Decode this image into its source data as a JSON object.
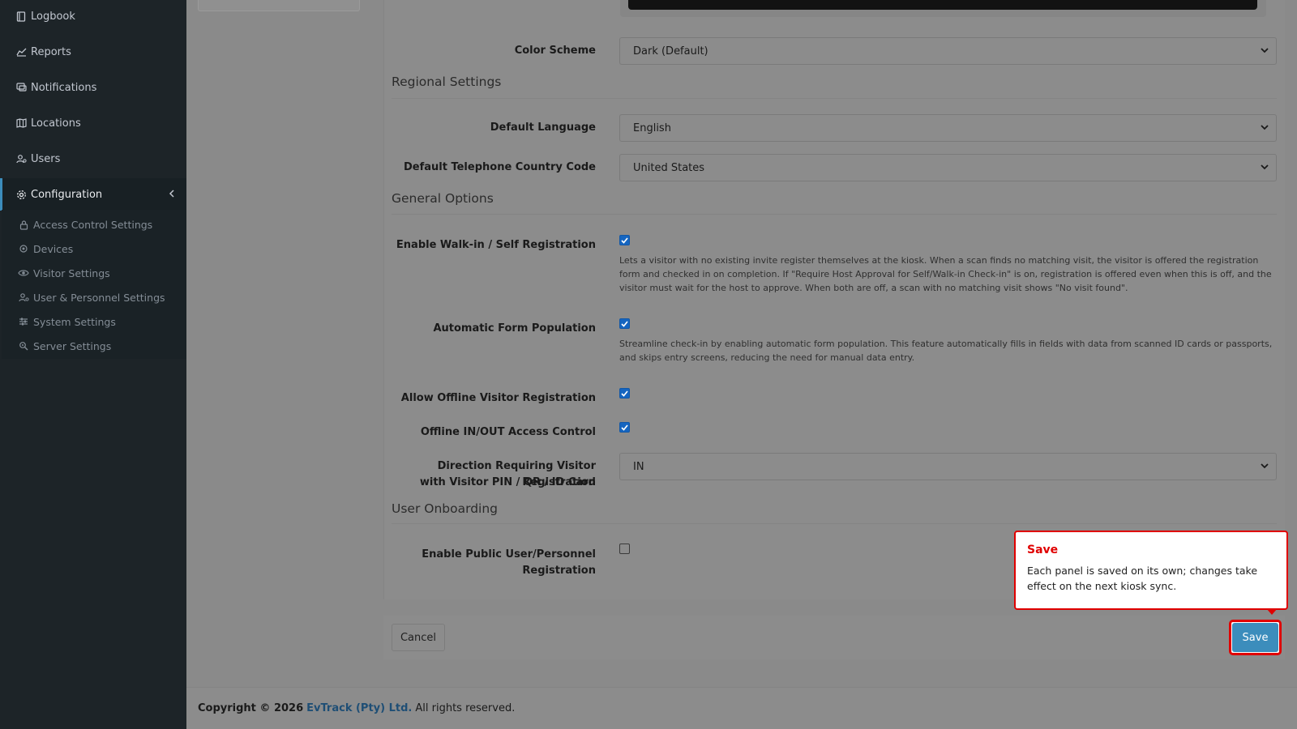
{
  "sidebar": {
    "items": [
      {
        "label": "Logbook",
        "icon": "book-icon"
      },
      {
        "label": "Reports",
        "icon": "chart-icon"
      },
      {
        "label": "Notifications",
        "icon": "chat-icon"
      },
      {
        "label": "Locations",
        "icon": "map-icon"
      },
      {
        "label": "Users",
        "icon": "users-icon"
      },
      {
        "label": "Configuration",
        "icon": "gear-icon"
      }
    ],
    "sub_items": [
      {
        "label": "Access Control Settings",
        "icon": "lock-icon"
      },
      {
        "label": "Devices",
        "icon": "device-icon"
      },
      {
        "label": "Visitor Settings",
        "icon": "eye-icon"
      },
      {
        "label": "User & Personnel Settings",
        "icon": "user-gear-icon"
      },
      {
        "label": "System Settings",
        "icon": "sliders-icon"
      },
      {
        "label": "Server Settings",
        "icon": "server-icon"
      }
    ]
  },
  "form": {
    "color_scheme": {
      "label": "Color Scheme",
      "value": "Dark (Default)"
    },
    "regional_title": "Regional Settings",
    "default_language": {
      "label": "Default Language",
      "value": "English"
    },
    "default_country_code": {
      "label": "Default Telephone Country Code",
      "value": "United States"
    },
    "general_title": "General Options",
    "walkin": {
      "label": "Enable Walk-in / Self Registration",
      "checked": true,
      "help": "Lets a visitor with no existing invite register themselves at the kiosk. When a scan finds no matching visit, the visitor is offered the registration form and checked in on completion. If \"Require Host Approval for Self/Walk-in Check-in\" is on, registration is offered even when this is off, and the visitor must wait for the host to approve. When both are off, a scan with no matching visit shows \"No visit found\"."
    },
    "auto_form": {
      "label": "Automatic Form Population",
      "checked": true,
      "help": "Streamline check-in by enabling automatic form population. This feature automatically fills in fields with data from scanned ID cards or passports, and skips entry screens, reducing the need for manual data entry."
    },
    "offline_reg": {
      "label": "Allow Offline Visitor Registration",
      "checked": true
    },
    "offline_access": {
      "label": "Offline IN/OUT Access Control",
      "checked": true
    },
    "direction": {
      "label_line1": "Direction Requiring Visitor Registration",
      "label_line2": "with Visitor PIN / QR / ID Card",
      "value": "IN"
    },
    "onboarding_title": "User Onboarding",
    "public_reg": {
      "label_line1": "Enable Public User/Personnel",
      "label_line2": "Registration",
      "checked": false
    }
  },
  "buttons": {
    "cancel": "Cancel",
    "save": "Save"
  },
  "tooltip": {
    "title": "Save",
    "body": "Each panel is saved on its own; changes take effect on the next kiosk sync."
  },
  "footer": {
    "prefix": "Copyright © 2026",
    "brand": "EvTrack (Pty) Ltd.",
    "suffix": "All rights reserved."
  }
}
